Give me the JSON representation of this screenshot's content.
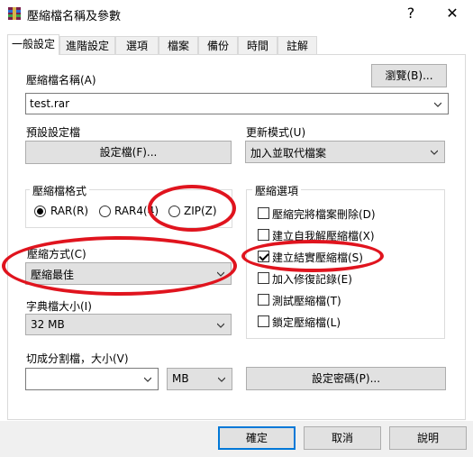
{
  "window": {
    "title": "壓縮檔名稱及參數",
    "help_glyph": "?",
    "close_glyph": "✕"
  },
  "tabs": [
    "一般設定",
    "進階設定",
    "選項",
    "檔案",
    "備份",
    "時間",
    "註解"
  ],
  "archive_name": {
    "label": "壓縮檔名稱(A)",
    "browse_label": "瀏覽(B)...",
    "value": "test.rar"
  },
  "profile": {
    "label": "預設設定檔",
    "button_label": "設定檔(F)..."
  },
  "update_mode": {
    "label": "更新模式(U)",
    "value": "加入並取代檔案"
  },
  "format": {
    "title": "壓縮檔格式",
    "options": [
      {
        "label": "RAR(R)",
        "selected": true
      },
      {
        "label": "RAR4(4)",
        "selected": false
      },
      {
        "label": "ZIP(Z)",
        "selected": false
      }
    ]
  },
  "compression": {
    "label": "壓縮方式(C)",
    "value": "壓縮最佳"
  },
  "dictionary": {
    "label": "字典檔大小(I)",
    "value": "32 MB"
  },
  "split": {
    "label": "切成分割檔，大小(V)",
    "value": "",
    "unit": "MB"
  },
  "archive_options": {
    "title": "壓縮選項",
    "items": [
      {
        "label": "壓縮完將檔案刪除(D)",
        "checked": false
      },
      {
        "label": "建立自我解壓縮檔(X)",
        "checked": false
      },
      {
        "label": "建立結實壓縮檔(S)",
        "checked": true
      },
      {
        "label": "加入修復記錄(E)",
        "checked": false
      },
      {
        "label": "測試壓縮檔(T)",
        "checked": false
      },
      {
        "label": "鎖定壓縮檔(L)",
        "checked": false
      }
    ]
  },
  "password_button": "設定密碼(P)...",
  "footer": {
    "ok": "確定",
    "cancel": "取消",
    "help": "說明"
  },
  "annotation_color": "#e0141e"
}
